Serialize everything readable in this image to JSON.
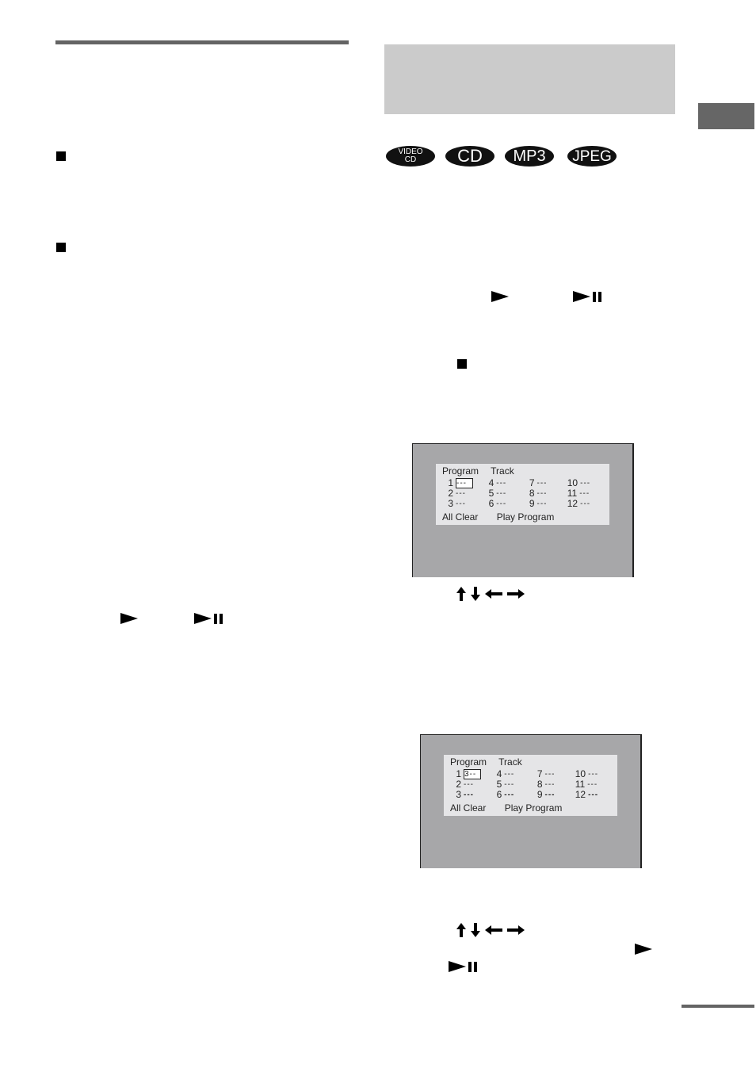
{
  "page": {
    "section_heading_box": "",
    "side_tab_label": ""
  },
  "disc_badges": [
    {
      "icon": "video-cd-badge",
      "lines": [
        "VIDEO",
        "CD"
      ]
    },
    {
      "icon": "cd-badge",
      "label": "CD"
    },
    {
      "icon": "mp3-badge",
      "label": "MP3"
    },
    {
      "icon": "jpeg-badge",
      "label": "JPEG"
    }
  ],
  "icons": {
    "bullet": "black-square-bullet",
    "play": "play-icon",
    "play_pause": "play-pause-icon",
    "stop": "stop-icon",
    "arrows": [
      "up-arrow-icon",
      "down-arrow-icon",
      "left-arrow-icon",
      "right-arrow-icon"
    ]
  },
  "screens": [
    {
      "header": [
        "Program",
        "Track"
      ],
      "rows": [
        [
          {
            "num": "1",
            "val": "---",
            "selected": true
          },
          {
            "num": "4",
            "val": "---"
          },
          {
            "num": "7",
            "val": "---"
          },
          {
            "num": "10",
            "val": "---"
          }
        ],
        [
          {
            "num": "2",
            "val": "---"
          },
          {
            "num": "5",
            "val": "---"
          },
          {
            "num": "8",
            "val": "---"
          },
          {
            "num": "11",
            "val": "---"
          }
        ],
        [
          {
            "num": "3",
            "val": "---"
          },
          {
            "num": "6",
            "val": "---"
          },
          {
            "num": "9",
            "val": "---"
          },
          {
            "num": "12",
            "val": "---"
          }
        ]
      ],
      "footer": [
        "All Clear",
        "Play Program"
      ]
    },
    {
      "header": [
        "Program",
        "Track"
      ],
      "rows": [
        [
          {
            "num": "1",
            "val": "3--",
            "selected": true
          },
          {
            "num": "4",
            "val": "---"
          },
          {
            "num": "7",
            "val": "---"
          },
          {
            "num": "10",
            "val": "---"
          }
        ],
        [
          {
            "num": "2",
            "val": "---"
          },
          {
            "num": "5",
            "val": "---"
          },
          {
            "num": "8",
            "val": "---"
          },
          {
            "num": "11",
            "val": "---"
          }
        ],
        [
          {
            "num": "3",
            "val": "---",
            "bold": true
          },
          {
            "num": "6",
            "val": "---",
            "bold": true
          },
          {
            "num": "9",
            "val": "---",
            "bold": true
          },
          {
            "num": "12",
            "val": "---",
            "bold": true
          }
        ]
      ],
      "footer": [
        "All Clear",
        "Play Program"
      ]
    }
  ],
  "colors": {
    "rule": "#646464",
    "heading_box": "#cbcbcb",
    "side_tab": "#666666",
    "screen_bg": "#a7a7a9",
    "panel_bg": "#e5e5e7"
  }
}
